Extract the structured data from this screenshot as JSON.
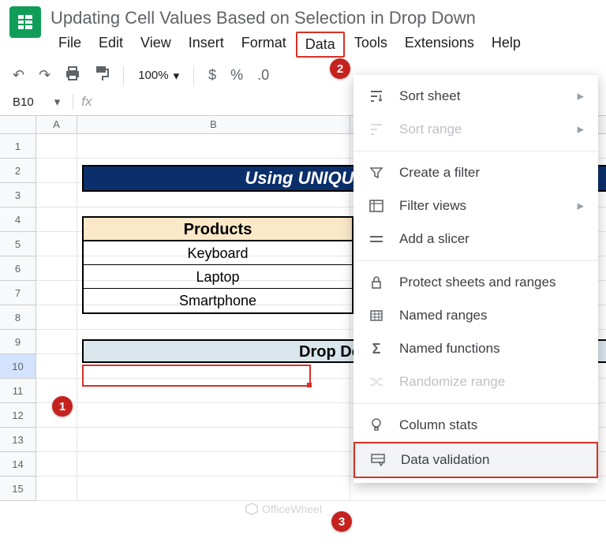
{
  "title": "Updating Cell Values Based on Selection in Drop Down",
  "menu": [
    "File",
    "Edit",
    "View",
    "Insert",
    "Format",
    "Data",
    "Tools",
    "Extensions",
    "Help"
  ],
  "active_menu": "Data",
  "toolbar": {
    "zoom": "100%",
    "currency": "$",
    "percent": "%",
    "decimal": ".0"
  },
  "namebox": "B10",
  "fx_label": "fx",
  "columns": [
    "A",
    "B"
  ],
  "row_count": 15,
  "selected_row": 10,
  "banner": "Using UNIQUE, FILTER, S",
  "products_header": "Products",
  "products": [
    "Keyboard",
    "Laptop",
    "Smartphone"
  ],
  "dropdown_header": "Drop Down Li",
  "markers": {
    "m1": "1",
    "m2": "2",
    "m3": "3"
  },
  "data_menu": {
    "sort_sheet": "Sort sheet",
    "sort_range": "Sort range",
    "create_filter": "Create a filter",
    "filter_views": "Filter views",
    "add_slicer": "Add a slicer",
    "protect": "Protect sheets and ranges",
    "named_ranges": "Named ranges",
    "named_functions": "Named functions",
    "randomize": "Randomize range",
    "column_stats": "Column stats",
    "data_validation": "Data validation"
  },
  "watermark": "OfficeWheel"
}
